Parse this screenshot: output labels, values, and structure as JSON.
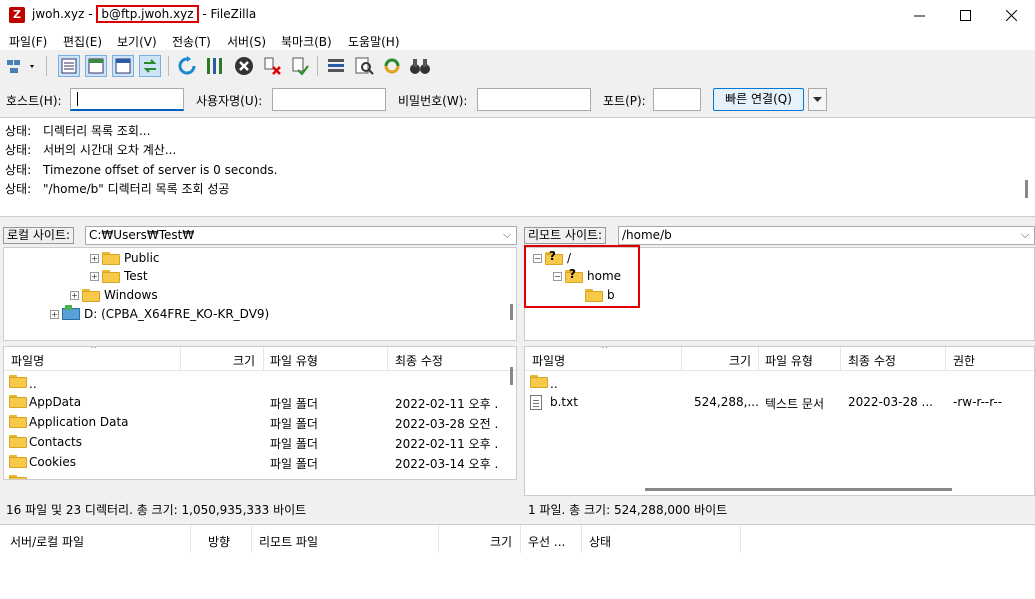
{
  "window": {
    "title_prefix": "jwoh.xyz -",
    "title_highlight": "b@ftp.jwoh.xyz",
    "title_suffix": "- FileZilla",
    "app_icon": "filezilla-icon"
  },
  "menu": [
    "파일(F)",
    "편집(E)",
    "보기(V)",
    "전송(T)",
    "서버(S)",
    "북마크(B)",
    "도움말(H)"
  ],
  "quickconnect": {
    "host_label": "호스트(H):",
    "host_value": "",
    "user_label": "사용자명(U):",
    "user_value": "",
    "pass_label": "비밀번호(W):",
    "pass_value": "",
    "port_label": "포트(P):",
    "port_value": "",
    "connect_label": "빠른 연결(Q)"
  },
  "log": [
    {
      "tag": "상태:",
      "text": "디렉터리 목록 조회..."
    },
    {
      "tag": "상태:",
      "text": "서버의 시간대 오차 계산..."
    },
    {
      "tag": "상태:",
      "text": "Timezone offset of server is 0 seconds."
    },
    {
      "tag": "상태:",
      "text": "\"/home/b\" 디렉터리 목록 조회 성공"
    }
  ],
  "local": {
    "site_label": "로컬 사이트:",
    "path": "C:₩Users₩Test₩",
    "tree": [
      {
        "label": "Public",
        "expander": "+"
      },
      {
        "label": "Test",
        "expander": "+"
      },
      {
        "label": "Windows",
        "expander": "+"
      },
      {
        "label": "D: (CPBA_X64FRE_KO-KR_DV9)",
        "expander": "+"
      }
    ],
    "columns": [
      "파일명",
      "크기",
      "파일 유형",
      "최종 수정"
    ],
    "files": [
      {
        "name": "..",
        "size": "",
        "type": "",
        "modified": ""
      },
      {
        "name": "AppData",
        "size": "",
        "type": "파일 폴더",
        "modified": "2022-02-11 오후 ."
      },
      {
        "name": "Application Data",
        "size": "",
        "type": "파일 폴더",
        "modified": "2022-03-28 오전 ."
      },
      {
        "name": "Contacts",
        "size": "",
        "type": "파일 폴더",
        "modified": "2022-02-11 오후 ."
      },
      {
        "name": "Cookies",
        "size": "",
        "type": "파일 폴더",
        "modified": "2022-03-14 오후 ."
      }
    ],
    "status": "16 파일 및 23 디렉터리. 총 크기: 1,050,935,333 바이트"
  },
  "remote": {
    "site_label": "리모트 사이트:",
    "path": "/home/b",
    "tree": [
      {
        "label": "/",
        "expander": "−"
      },
      {
        "label": "home",
        "expander": "−"
      },
      {
        "label": "b",
        "expander": ""
      }
    ],
    "columns": [
      "파일명",
      "크기",
      "파일 유형",
      "최종 수정",
      "권한"
    ],
    "files": [
      {
        "name": "..",
        "size": "",
        "type": "",
        "modified": "",
        "perm": ""
      },
      {
        "name": "b.txt",
        "size": "524,288,...",
        "type": "텍스트 문서",
        "modified": "2022-03-28 ...",
        "perm": "-rw-r--r--"
      }
    ],
    "status": "1 파일. 총 크기: 524,288,000 바이트"
  },
  "queue": {
    "columns": [
      "서버/로컬 파일",
      "방향",
      "리모트 파일",
      "크기",
      "우선 ...",
      "상태"
    ]
  },
  "colors": {
    "highlight": "#e00000",
    "folder": "#f7c948",
    "accent": "#0078d7"
  }
}
